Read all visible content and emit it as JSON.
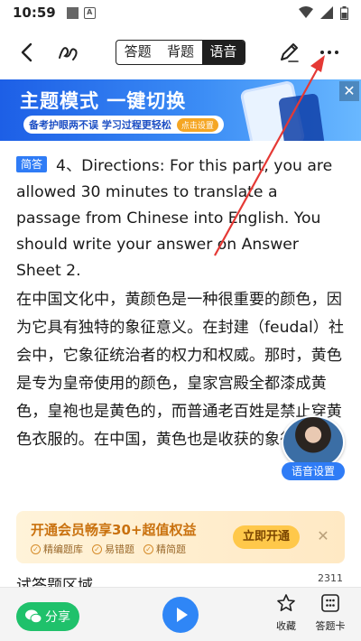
{
  "status_bar": {
    "time": "10:59"
  },
  "toolbar": {
    "tabs": [
      {
        "label": "答题",
        "active": false
      },
      {
        "label": "背题",
        "active": false
      },
      {
        "label": "语音",
        "active": true
      }
    ]
  },
  "banner": {
    "title": "主题模式 一键切换",
    "subtitle": "备考护眼两不误 学习过程更轻松",
    "cta": "点击设置",
    "close_label": "✕"
  },
  "question": {
    "badge": "简答",
    "text": "4、Directions: For this part, you are allowed 30 minutes to translate a passage from Chinese into English. You should write your answer on Answer Sheet 2.",
    "passage": "在中国文化中，黄颜色是一种很重要的颜色，因为它具有独特的象征意义。在封建（feudal）社会中，它象征统治者的权力和权威。那时，黄色是专为皇帝使用的颜色，皇家宫殿全都漆成黄色，皇袍也是黄色的，而普通老百姓是禁止穿黄色衣服的。在中国，黄色也是收获的象征。秋天"
  },
  "voice": {
    "label": "语音设置"
  },
  "vip": {
    "title": "开通会员畅享30+超值权益",
    "features": [
      "精编题库",
      "易错题",
      "精简题"
    ],
    "button": "立即开通",
    "close_label": "✕"
  },
  "answer": {
    "label": "试答题区域",
    "count": "2311"
  },
  "bottom_bar": {
    "share": "分享",
    "favorite": "收藏",
    "answer_card": "答题卡"
  },
  "colors": {
    "accent_blue": "#2f7cf6",
    "share_green": "#1fc16b",
    "annotation_red": "#e53935"
  }
}
